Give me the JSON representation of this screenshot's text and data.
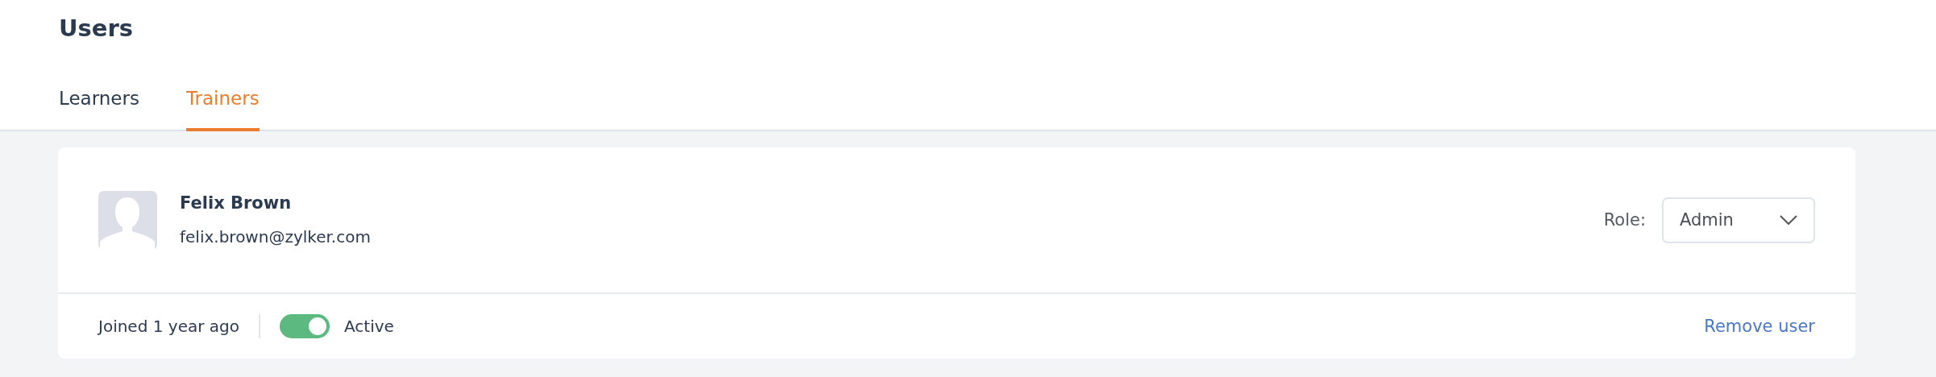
{
  "page_title": "Users",
  "tabs": [
    {
      "label": "Learners",
      "selected": false
    },
    {
      "label": "Trainers",
      "selected": true
    }
  ],
  "user": {
    "name": "Felix Brown",
    "email": "felix.brown@zylker.com",
    "role_label": "Role:",
    "role": "Admin",
    "joined": "Joined 1 year ago",
    "active": true,
    "status": "Active",
    "remove": "Remove user"
  }
}
